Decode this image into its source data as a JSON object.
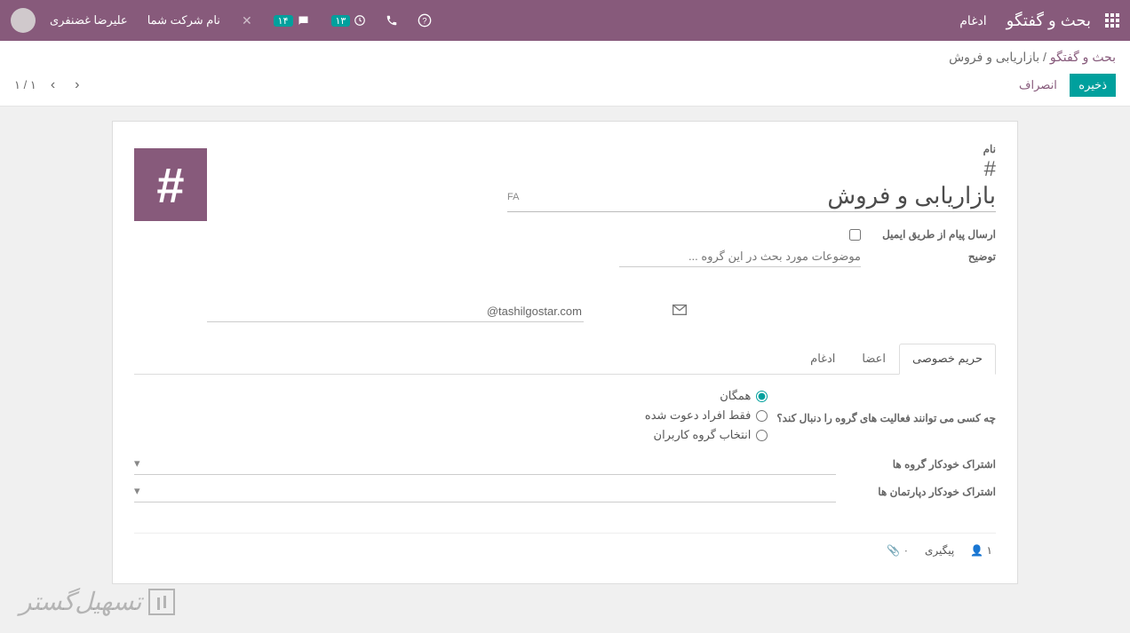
{
  "header": {
    "module": "بحث و گفتگو",
    "menu_merge": "ادغام",
    "help_icon": "help-icon",
    "phone_icon": "phone-icon",
    "badge_clock": "۱۳",
    "badge_chat": "۱۴",
    "company": "نام شرکت شما",
    "user": "علیرضا غضنفری"
  },
  "breadcrumb": {
    "parent": "بحث و گفتگو",
    "current": "بازاریابی و فروش"
  },
  "actions": {
    "save": "ذخیره",
    "discard": "انصراف",
    "pager": "۱ / ۱"
  },
  "form": {
    "name_label": "نام",
    "name_value": "بازاریابی و فروش",
    "lang": "FA",
    "email_send_label": "ارسال پیام از طریق ایمیل",
    "desc_label": "توضیح",
    "desc_placeholder": "موضوعات مورد بحث در این گروه ...",
    "email_suffix": "@tashilgostar.com"
  },
  "tabs": {
    "privacy": "حریم خصوصی",
    "members": "اعضا",
    "merge": "ادغام"
  },
  "privacy": {
    "question": "چه کسی می توانند فعالیت های گروه را دنبال کند؟",
    "opt_all": "همگان",
    "opt_invited": "فقط افراد دعوت شده",
    "opt_group": "انتخاب گروه کاربران",
    "auto_groups": "اشتراک خودکار گروه ها",
    "auto_depts": "اشتراک خودکار دپارتمان ها"
  },
  "footer": {
    "follow": "پیگیری",
    "count": "۱",
    "attach": "۰"
  }
}
